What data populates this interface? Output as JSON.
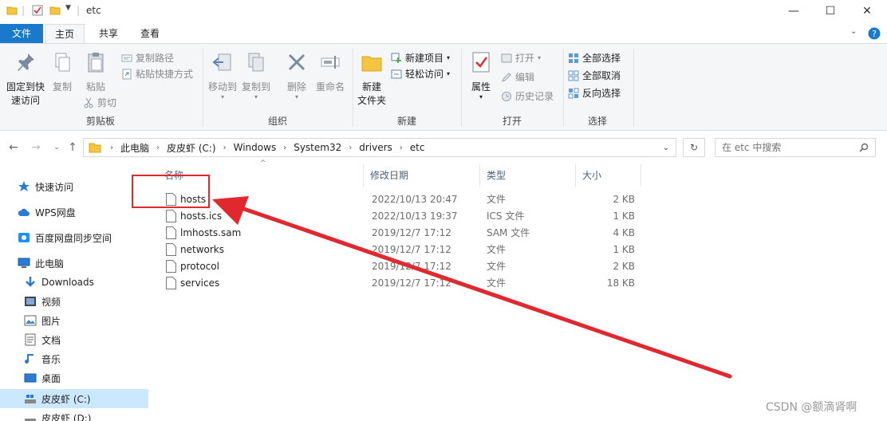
{
  "window": {
    "title": "etc",
    "controls": {
      "minimize": "—",
      "maximize": "☐",
      "close": "✕"
    }
  },
  "tabs": {
    "file": "文件",
    "home": "主页",
    "share": "共享",
    "view": "查看"
  },
  "ribbon": {
    "clipboard": {
      "label": "剪贴板",
      "pin": "固定到快\n速访问",
      "copy": "复制",
      "paste": "粘贴",
      "copy_path": "复制路径",
      "paste_shortcut": "粘贴快捷方式",
      "cut": "剪切"
    },
    "organize": {
      "label": "组织",
      "move_to": "移动到",
      "copy_to": "复制到",
      "delete": "删除",
      "rename": "重命名"
    },
    "new": {
      "label": "新建",
      "new_folder": "新建\n文件夹",
      "new_item": "新建项目",
      "easy_access": "轻松访问"
    },
    "open": {
      "label": "打开",
      "properties": "属性",
      "open": "打开",
      "edit": "编辑",
      "history": "历史记录"
    },
    "select": {
      "label": "选择",
      "select_all": "全部选择",
      "select_none": "全部取消",
      "invert": "反向选择"
    }
  },
  "address": {
    "crumbs": [
      "此电脑",
      "皮皮虾 (C:)",
      "Windows",
      "System32",
      "drivers",
      "etc"
    ]
  },
  "search": {
    "placeholder": "在 etc 中搜索"
  },
  "navpane": {
    "items": [
      {
        "label": "快速访问",
        "icon": "star-icon"
      },
      {
        "label": "WPS网盘",
        "icon": "cloud-icon"
      },
      {
        "label": "百度网盘同步空间",
        "icon": "baidu-icon"
      },
      {
        "label": "此电脑",
        "icon": "computer-icon"
      },
      {
        "label": "Downloads",
        "icon": "download-icon"
      },
      {
        "label": "视频",
        "icon": "video-icon"
      },
      {
        "label": "图片",
        "icon": "picture-icon"
      },
      {
        "label": "文档",
        "icon": "document-icon"
      },
      {
        "label": "音乐",
        "icon": "music-icon"
      },
      {
        "label": "桌面",
        "icon": "desktop-icon"
      },
      {
        "label": "皮皮虾 (C:)",
        "icon": "drive-icon"
      },
      {
        "label": "皮皮虾 (D:)",
        "icon": "drive-icon"
      }
    ]
  },
  "columns": {
    "name": "名称",
    "modified": "修改日期",
    "type": "类型",
    "size": "大小"
  },
  "files": [
    {
      "name": "hosts",
      "modified": "2022/10/13 20:47",
      "type": "文件",
      "size": "2 KB"
    },
    {
      "name": "hosts.ics",
      "modified": "2022/10/13 19:37",
      "type": "ICS 文件",
      "size": "1 KB"
    },
    {
      "name": "lmhosts.sam",
      "modified": "2019/12/7 17:12",
      "type": "SAM 文件",
      "size": "4 KB"
    },
    {
      "name": "networks",
      "modified": "2019/12/7 17:12",
      "type": "文件",
      "size": "1 KB"
    },
    {
      "name": "protocol",
      "modified": "2019/12/7 17:12",
      "type": "文件",
      "size": "2 KB"
    },
    {
      "name": "services",
      "modified": "2019/12/7 17:12",
      "type": "文件",
      "size": "18 KB"
    }
  ],
  "colors": {
    "accent": "#1979ca",
    "annotation": "#e0282e",
    "selected": "#cce8ff"
  },
  "watermark": "CSDN @额滴肾啊"
}
